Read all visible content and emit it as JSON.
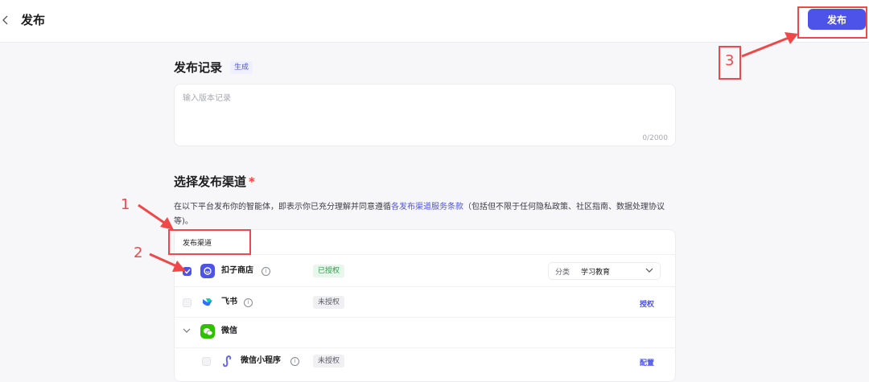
{
  "header": {
    "title": "发布",
    "publish_label": "发布"
  },
  "record": {
    "title": "发布记录",
    "generate_label": "生成",
    "placeholder": "输入版本记录",
    "counter": "0/2000"
  },
  "channels": {
    "title": "选择发布渠道",
    "required_mark": "*",
    "description_prefix": "在以下平台发布你的智能体，即表示你已充分理解并同意遵循",
    "description_link": "各发布渠道服务条款",
    "description_suffix": "（包括但不限于任何隐私政策、社区指南、数据处理协议等)。",
    "table_header": "发布渠道",
    "rows": [
      {
        "name": "扣子商店",
        "status": "已授权",
        "checked": true,
        "category_label": "分类",
        "category_value": "学习教育"
      },
      {
        "name": "飞书",
        "status": "未授权",
        "checked": false,
        "action": "授权"
      },
      {
        "name": "微信",
        "group": true
      },
      {
        "name": "微信小程序",
        "status": "未授权",
        "checked": false,
        "action": "配置"
      }
    ]
  },
  "annotations": {
    "n1": "1",
    "n2": "2",
    "n3": "3"
  },
  "colors": {
    "accent": "#4d53e8",
    "annotation": "#f04848",
    "authorized": "#2a9d4b"
  }
}
